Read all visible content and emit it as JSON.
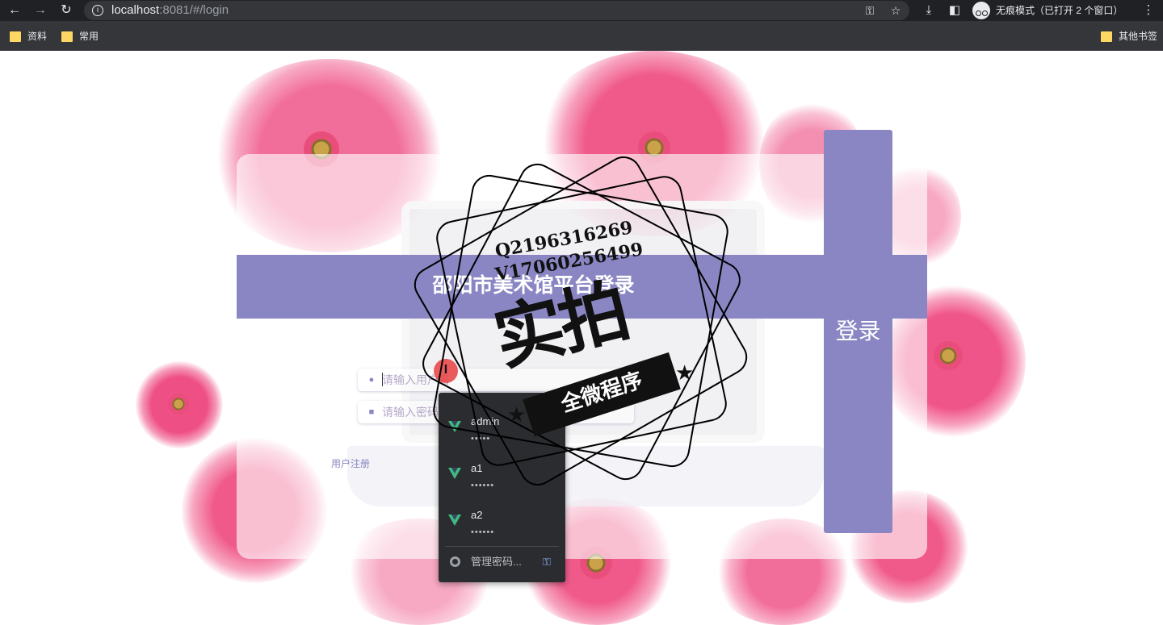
{
  "browser": {
    "url_host": "localhost",
    "url_rest": ":8081/#/login",
    "incognito_label": "无痕模式（已打开 2 个窗口）",
    "bookmarks": [
      "资料",
      "常用"
    ],
    "other_bookmarks": "其他书签",
    "icons": {
      "back": "back-arrow-icon",
      "forward": "forward-arrow-icon",
      "reload": "reload-icon",
      "site_info": "info-icon",
      "password_key": "key-icon",
      "bookmark_star": "star-icon",
      "download": "download-icon",
      "side_panel": "side-panel-icon",
      "menu": "kebab-menu-icon"
    }
  },
  "login": {
    "title": "邵阳市美术馆平台登录",
    "username_placeholder": "请输入用户名",
    "password_placeholder": "请输入密码",
    "submit_label": "登录",
    "register_link": "用户注册",
    "accent_color": "#8986c3"
  },
  "autofill": {
    "entries": [
      {
        "user": "admin",
        "password_mask": "•••••"
      },
      {
        "user": "a1",
        "password_mask": "••••••"
      },
      {
        "user": "a2",
        "password_mask": "••••••"
      }
    ],
    "manage_label": "管理密码..."
  },
  "watermark": {
    "contact_q": "Q2196316269",
    "contact_v": "V17060256499",
    "big_text": "实拍",
    "ribbon_text": "全微程序"
  }
}
